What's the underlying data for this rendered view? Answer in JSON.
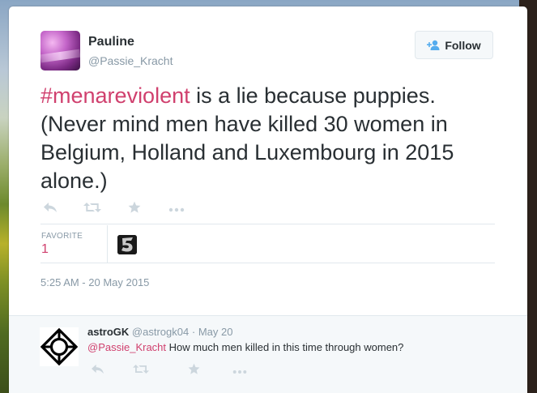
{
  "tweet": {
    "author_name": "Pauline",
    "author_handle": "@Passie_Kracht",
    "follow_label": "Follow",
    "hashtag": "#menareviolent",
    "text_rest": " is a lie because puppies. (Never mind men have killed 30 women in Belgium, Holland and Luxembourg in 2015 alone.)",
    "favorite_label": "FAVORITE",
    "favorite_count": "1",
    "timestamp": "5:25 AM - 20 May 2015"
  },
  "reply": {
    "author_name": "astroGK",
    "author_handle": "@astrogk04",
    "separator": "·",
    "date": "May 20",
    "mention": "@Passie_Kracht",
    "text": " How much men killed in this time through women?"
  },
  "icons": {
    "reply": "reply-icon",
    "retweet": "retweet-icon",
    "favorite": "star-icon",
    "more": "more-icon",
    "follow": "add-person-icon"
  },
  "colors": {
    "accent": "#d0406e",
    "text": "#292f33",
    "muted": "#8899a6",
    "icon": "#ccd6dd",
    "follow_icon": "#55acee"
  }
}
